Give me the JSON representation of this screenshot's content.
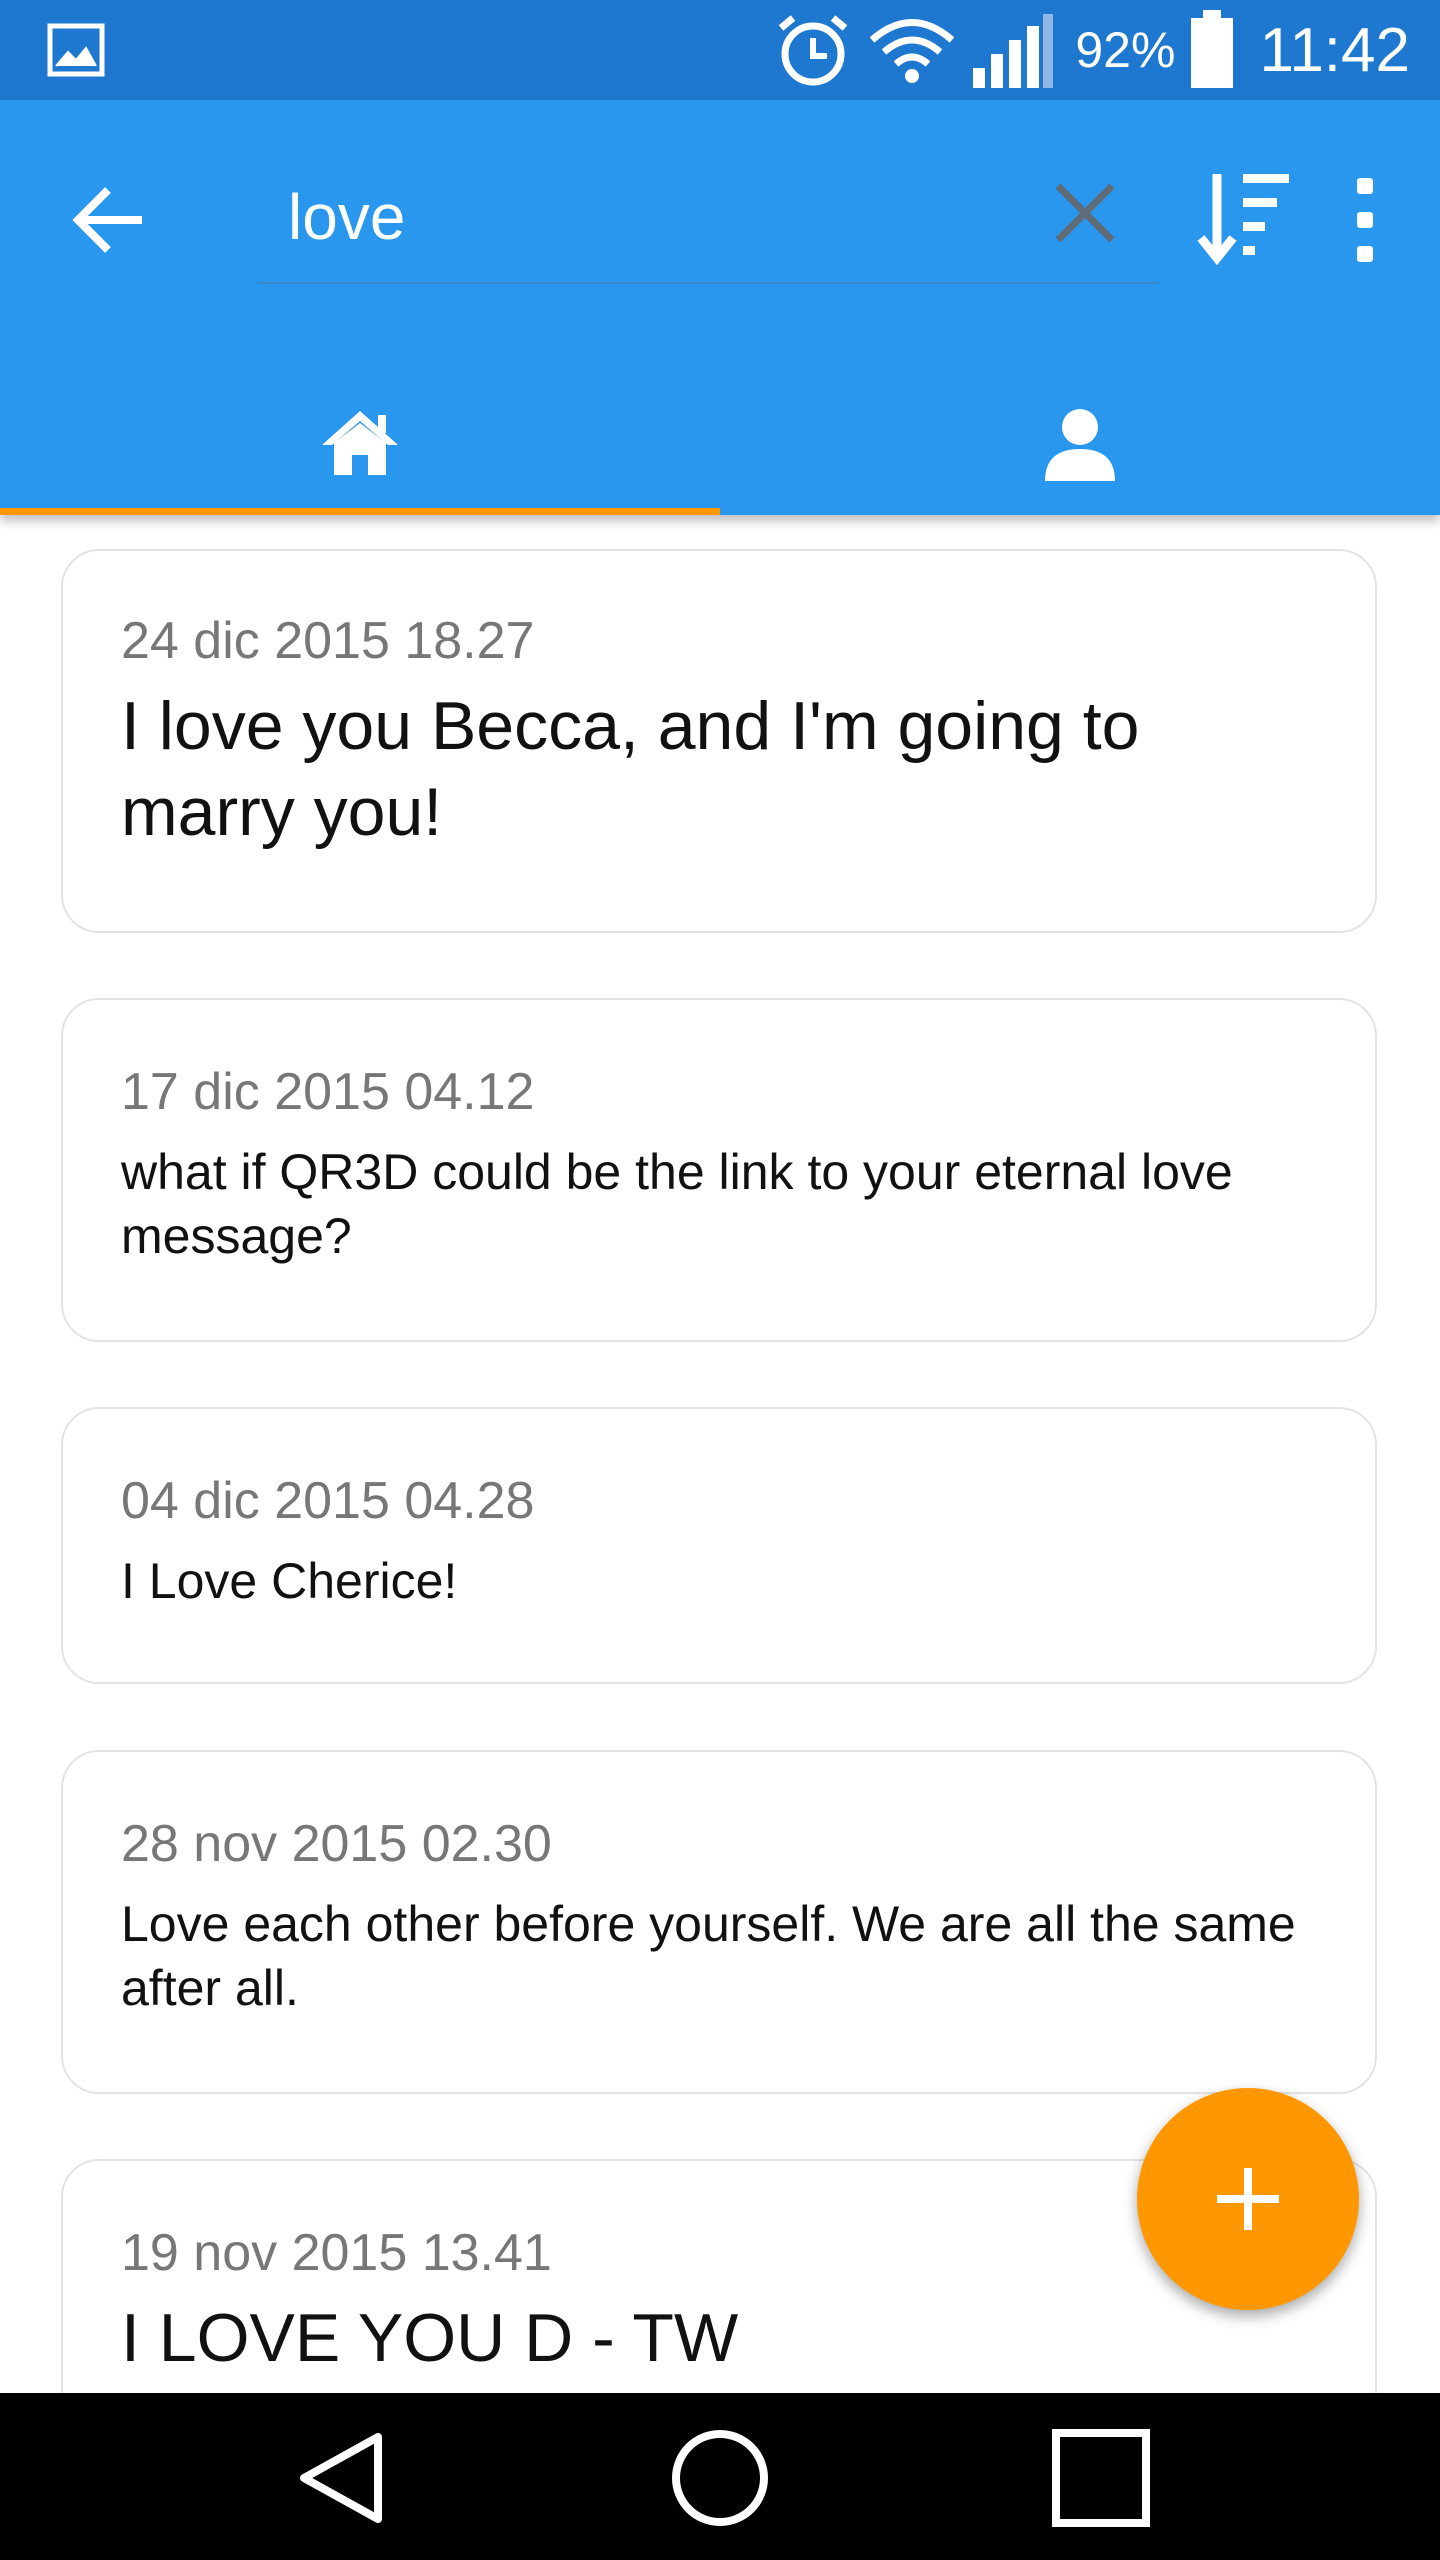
{
  "status_bar": {
    "battery_percent": "92%",
    "time": "11:42",
    "icons": [
      "gallery-icon",
      "alarm-icon",
      "wifi-icon",
      "signal-icon",
      "battery-icon"
    ]
  },
  "app_bar": {
    "search_value": "love",
    "icons": [
      "back-arrow-icon",
      "close-icon",
      "sort-icon",
      "more-vert-icon"
    ],
    "accent_color": "#2a97ee",
    "tabs": [
      {
        "name": "home",
        "icon": "home-icon",
        "selected": true
      },
      {
        "name": "user",
        "icon": "person-icon",
        "selected": false
      }
    ],
    "indicator_color": "#ff9800"
  },
  "cards": [
    {
      "date": "24 dic 2015 18.27",
      "message": "I love you Becca, and I'm going to marry you!"
    },
    {
      "date": "17 dic 2015 04.12",
      "message": "what if QR3D could be the link to your eternal love message?"
    },
    {
      "date": "04 dic 2015 04.28",
      "message": "I Love Cherice!"
    },
    {
      "date": "28 nov 2015 02.30",
      "message": "Love each other before yourself. We are all the same after all."
    },
    {
      "date": "19 nov 2015 13.41",
      "message": "I LOVE YOU D - TW"
    }
  ],
  "fab": {
    "icon": "plus-icon",
    "color": "#ff9800"
  },
  "nav_bar": {
    "icons": [
      "back-triangle-icon",
      "home-circle-icon",
      "recents-square-icon"
    ]
  }
}
